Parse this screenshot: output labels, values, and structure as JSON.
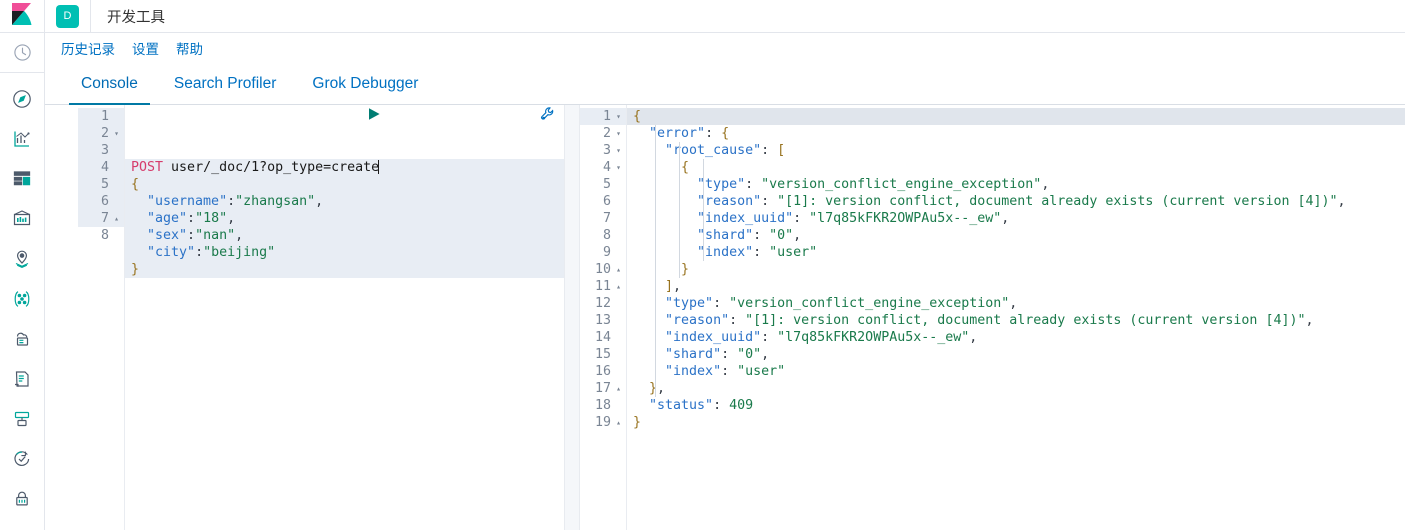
{
  "header": {
    "logo_icon": "kibana-logo-icon",
    "space_badge": "D",
    "app_title": "开发工具"
  },
  "sidebar": {
    "items": [
      {
        "name": "recently-viewed",
        "icon": "clock-icon",
        "separator_after": true
      },
      {
        "name": "discover",
        "icon": "compass-icon",
        "separator_after": false
      },
      {
        "name": "visualize",
        "icon": "bar-chart-icon",
        "separator_after": false
      },
      {
        "name": "dashboard",
        "icon": "dashboard-icon",
        "separator_after": false
      },
      {
        "name": "canvas",
        "icon": "canvas-icon",
        "separator_after": false
      },
      {
        "name": "maps",
        "icon": "map-pin-icon",
        "separator_after": false
      },
      {
        "name": "machine-learning",
        "icon": "ml-nodes-icon",
        "separator_after": false
      },
      {
        "name": "infrastructure",
        "icon": "infrastructure-icon",
        "separator_after": false
      },
      {
        "name": "logs",
        "icon": "logs-icon",
        "separator_after": false
      },
      {
        "name": "apm",
        "icon": "apm-icon",
        "separator_after": false
      },
      {
        "name": "uptime",
        "icon": "uptime-icon",
        "separator_after": false
      },
      {
        "name": "siem",
        "icon": "lock-icon",
        "separator_after": false
      }
    ]
  },
  "menu": {
    "items": [
      {
        "label": "历史记录",
        "name": "menu-history"
      },
      {
        "label": "设置",
        "name": "menu-settings"
      },
      {
        "label": "帮助",
        "name": "menu-help"
      }
    ]
  },
  "tabs": {
    "active_index": 0,
    "items": [
      {
        "label": "Console",
        "name": "tab-console"
      },
      {
        "label": "Search Profiler",
        "name": "tab-search-profiler"
      },
      {
        "label": "Grok Debugger",
        "name": "tab-grok-debugger"
      }
    ]
  },
  "request_editor": {
    "play_button_label": "send-request",
    "wrench_button_label": "request-options",
    "total_lines": 8,
    "lines": [
      {
        "n": 1,
        "fold": "",
        "highlight": true,
        "tokens": [
          {
            "t": "method",
            "v": "POST"
          },
          {
            "t": "plain",
            "v": " "
          },
          {
            "t": "url",
            "v": "user/_doc/1?op_type=create"
          }
        ],
        "caret": true
      },
      {
        "n": 2,
        "fold": "▾",
        "highlight": true,
        "tokens": [
          {
            "t": "brace",
            "v": "{"
          }
        ]
      },
      {
        "n": 3,
        "fold": "",
        "highlight": true,
        "tokens": [
          {
            "t": "plain",
            "v": "  "
          },
          {
            "t": "key",
            "v": "\"username\""
          },
          {
            "t": "punc",
            "v": ":"
          },
          {
            "t": "str",
            "v": "\"zhangsan\""
          },
          {
            "t": "punc",
            "v": ","
          }
        ]
      },
      {
        "n": 4,
        "fold": "",
        "highlight": true,
        "tokens": [
          {
            "t": "plain",
            "v": "  "
          },
          {
            "t": "key",
            "v": "\"age\""
          },
          {
            "t": "punc",
            "v": ":"
          },
          {
            "t": "str",
            "v": "\"18\""
          },
          {
            "t": "punc",
            "v": ","
          }
        ]
      },
      {
        "n": 5,
        "fold": "",
        "highlight": true,
        "tokens": [
          {
            "t": "plain",
            "v": "  "
          },
          {
            "t": "key",
            "v": "\"sex\""
          },
          {
            "t": "punc",
            "v": ":"
          },
          {
            "t": "str",
            "v": "\"nan\""
          },
          {
            "t": "punc",
            "v": ","
          }
        ]
      },
      {
        "n": 6,
        "fold": "",
        "highlight": true,
        "tokens": [
          {
            "t": "plain",
            "v": "  "
          },
          {
            "t": "key",
            "v": "\"city\""
          },
          {
            "t": "punc",
            "v": ":"
          },
          {
            "t": "str",
            "v": "\"beijing\""
          }
        ]
      },
      {
        "n": 7,
        "fold": "▴",
        "highlight": true,
        "tokens": [
          {
            "t": "brace",
            "v": "}"
          }
        ]
      },
      {
        "n": 8,
        "fold": "",
        "highlight": false,
        "tokens": []
      }
    ]
  },
  "response_editor": {
    "total_lines": 19,
    "lines": [
      {
        "n": 1,
        "fold": "▾",
        "highlight": true,
        "tokens": [
          {
            "t": "brace",
            "v": "{"
          }
        ]
      },
      {
        "n": 2,
        "fold": "▾",
        "highlight": false,
        "tokens": [
          {
            "t": "plain",
            "v": "  "
          },
          {
            "t": "key",
            "v": "\"error\""
          },
          {
            "t": "punc",
            "v": ": "
          },
          {
            "t": "brace",
            "v": "{"
          }
        ]
      },
      {
        "n": 3,
        "fold": "▾",
        "highlight": false,
        "tokens": [
          {
            "t": "plain",
            "v": "    "
          },
          {
            "t": "key",
            "v": "\"root_cause\""
          },
          {
            "t": "punc",
            "v": ": "
          },
          {
            "t": "brace",
            "v": "["
          }
        ]
      },
      {
        "n": 4,
        "fold": "▾",
        "highlight": false,
        "tokens": [
          {
            "t": "plain",
            "v": "      "
          },
          {
            "t": "brace",
            "v": "{"
          }
        ]
      },
      {
        "n": 5,
        "fold": "",
        "highlight": false,
        "tokens": [
          {
            "t": "plain",
            "v": "        "
          },
          {
            "t": "key",
            "v": "\"type\""
          },
          {
            "t": "punc",
            "v": ": "
          },
          {
            "t": "str",
            "v": "\"version_conflict_engine_exception\""
          },
          {
            "t": "punc",
            "v": ","
          }
        ]
      },
      {
        "n": 6,
        "fold": "",
        "highlight": false,
        "tokens": [
          {
            "t": "plain",
            "v": "        "
          },
          {
            "t": "key",
            "v": "\"reason\""
          },
          {
            "t": "punc",
            "v": ": "
          },
          {
            "t": "str",
            "v": "\"[1]: version conflict, document already exists (current version [4])\""
          },
          {
            "t": "punc",
            "v": ","
          }
        ]
      },
      {
        "n": 7,
        "fold": "",
        "highlight": false,
        "tokens": [
          {
            "t": "plain",
            "v": "        "
          },
          {
            "t": "key",
            "v": "\"index_uuid\""
          },
          {
            "t": "punc",
            "v": ": "
          },
          {
            "t": "str",
            "v": "\"l7q85kFKR2OWPAu5x--_ew\""
          },
          {
            "t": "punc",
            "v": ","
          }
        ]
      },
      {
        "n": 8,
        "fold": "",
        "highlight": false,
        "tokens": [
          {
            "t": "plain",
            "v": "        "
          },
          {
            "t": "key",
            "v": "\"shard\""
          },
          {
            "t": "punc",
            "v": ": "
          },
          {
            "t": "str",
            "v": "\"0\""
          },
          {
            "t": "punc",
            "v": ","
          }
        ]
      },
      {
        "n": 9,
        "fold": "",
        "highlight": false,
        "tokens": [
          {
            "t": "plain",
            "v": "        "
          },
          {
            "t": "key",
            "v": "\"index\""
          },
          {
            "t": "punc",
            "v": ": "
          },
          {
            "t": "str",
            "v": "\"user\""
          }
        ]
      },
      {
        "n": 10,
        "fold": "▴",
        "highlight": false,
        "tokens": [
          {
            "t": "plain",
            "v": "      "
          },
          {
            "t": "brace",
            "v": "}"
          }
        ]
      },
      {
        "n": 11,
        "fold": "▴",
        "highlight": false,
        "tokens": [
          {
            "t": "plain",
            "v": "    "
          },
          {
            "t": "brace",
            "v": "]"
          },
          {
            "t": "punc",
            "v": ","
          }
        ]
      },
      {
        "n": 12,
        "fold": "",
        "highlight": false,
        "tokens": [
          {
            "t": "plain",
            "v": "    "
          },
          {
            "t": "key",
            "v": "\"type\""
          },
          {
            "t": "punc",
            "v": ": "
          },
          {
            "t": "str",
            "v": "\"version_conflict_engine_exception\""
          },
          {
            "t": "punc",
            "v": ","
          }
        ]
      },
      {
        "n": 13,
        "fold": "",
        "highlight": false,
        "tokens": [
          {
            "t": "plain",
            "v": "    "
          },
          {
            "t": "key",
            "v": "\"reason\""
          },
          {
            "t": "punc",
            "v": ": "
          },
          {
            "t": "str",
            "v": "\"[1]: version conflict, document already exists (current version [4])\""
          },
          {
            "t": "punc",
            "v": ","
          }
        ]
      },
      {
        "n": 14,
        "fold": "",
        "highlight": false,
        "tokens": [
          {
            "t": "plain",
            "v": "    "
          },
          {
            "t": "key",
            "v": "\"index_uuid\""
          },
          {
            "t": "punc",
            "v": ": "
          },
          {
            "t": "str",
            "v": "\"l7q85kFKR2OWPAu5x--_ew\""
          },
          {
            "t": "punc",
            "v": ","
          }
        ]
      },
      {
        "n": 15,
        "fold": "",
        "highlight": false,
        "tokens": [
          {
            "t": "plain",
            "v": "    "
          },
          {
            "t": "key",
            "v": "\"shard\""
          },
          {
            "t": "punc",
            "v": ": "
          },
          {
            "t": "str",
            "v": "\"0\""
          },
          {
            "t": "punc",
            "v": ","
          }
        ]
      },
      {
        "n": 16,
        "fold": "",
        "highlight": false,
        "tokens": [
          {
            "t": "plain",
            "v": "    "
          },
          {
            "t": "key",
            "v": "\"index\""
          },
          {
            "t": "punc",
            "v": ": "
          },
          {
            "t": "str",
            "v": "\"user\""
          }
        ]
      },
      {
        "n": 17,
        "fold": "▴",
        "highlight": false,
        "tokens": [
          {
            "t": "plain",
            "v": "  "
          },
          {
            "t": "brace",
            "v": "}"
          },
          {
            "t": "punc",
            "v": ","
          }
        ]
      },
      {
        "n": 18,
        "fold": "",
        "highlight": false,
        "tokens": [
          {
            "t": "plain",
            "v": "  "
          },
          {
            "t": "key",
            "v": "\"status\""
          },
          {
            "t": "punc",
            "v": ": "
          },
          {
            "t": "num",
            "v": "409"
          }
        ]
      },
      {
        "n": 19,
        "fold": "▴",
        "highlight": false,
        "tokens": [
          {
            "t": "brace",
            "v": "}"
          }
        ]
      }
    ]
  },
  "colors": {
    "accent_teal": "#00BFB3",
    "link_blue": "#0071c2",
    "tab_underline": "#0079a5",
    "method_pink": "#d63c6b",
    "json_key": "#2b72c7",
    "json_string": "#1a7a4b",
    "line_highlight": "#e8edf4"
  }
}
